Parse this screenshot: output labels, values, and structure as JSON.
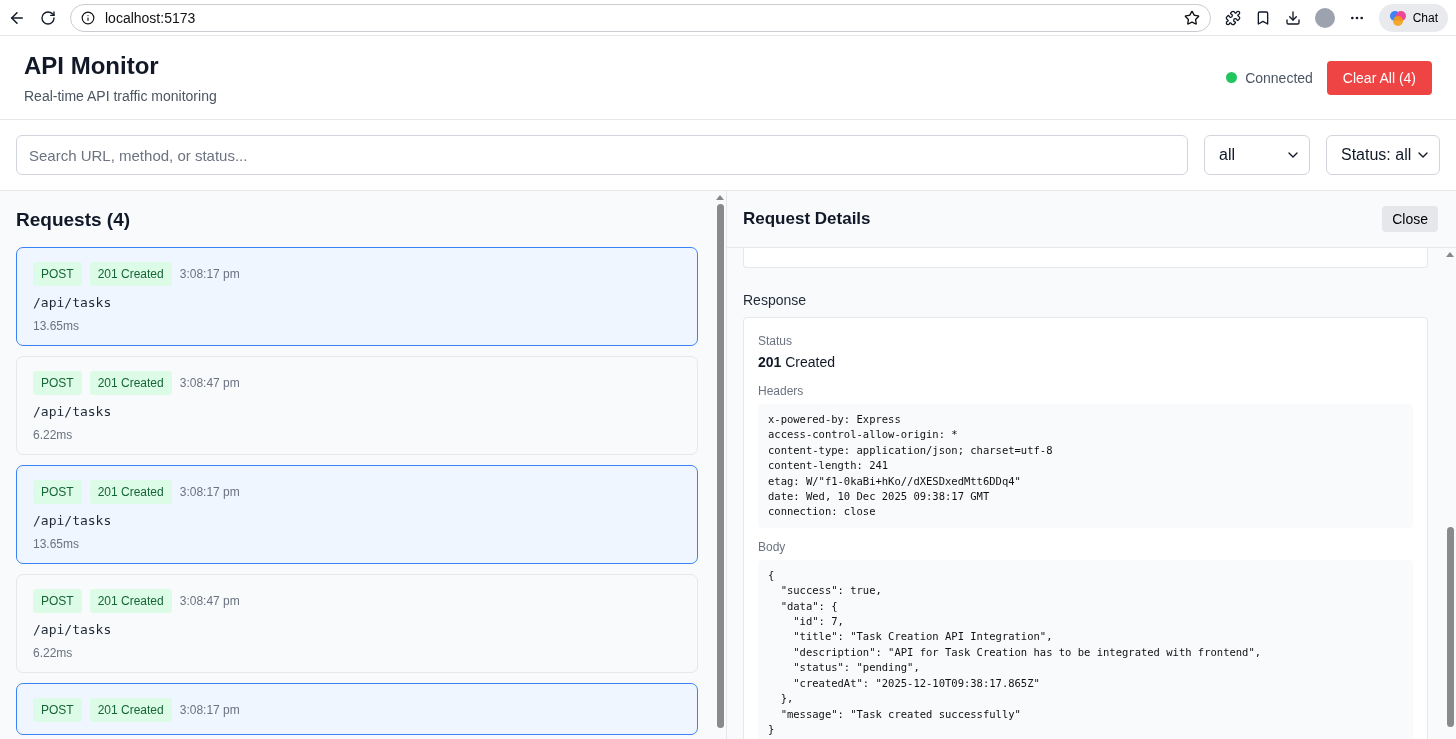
{
  "browser": {
    "url": "localhost:5173",
    "chat_label": "Chat"
  },
  "header": {
    "title": "API Monitor",
    "subtitle": "Real-time API traffic monitoring",
    "connection": {
      "label": "Connected",
      "connected": true
    },
    "clear_button": "Clear All (4)"
  },
  "filters": {
    "search": {
      "placeholder": "Search URL, method, or status..."
    },
    "method_select": "all",
    "status_select": "Status: all"
  },
  "requests": {
    "title": "Requests (4)",
    "items": [
      {
        "method": "POST",
        "status": "201 Created",
        "time": "3:08:17 pm",
        "url": "/api/tasks",
        "duration": "13.65ms",
        "selected": true
      },
      {
        "method": "POST",
        "status": "201 Created",
        "time": "3:08:47 pm",
        "url": "/api/tasks",
        "duration": "6.22ms",
        "selected": false
      },
      {
        "method": "POST",
        "status": "201 Created",
        "time": "3:08:17 pm",
        "url": "/api/tasks",
        "duration": "13.65ms",
        "selected": true
      },
      {
        "method": "POST",
        "status": "201 Created",
        "time": "3:08:47 pm",
        "url": "/api/tasks",
        "duration": "6.22ms",
        "selected": false
      },
      {
        "method": "POST",
        "status": "201 Created",
        "time": "3:08:17 pm",
        "selected": true
      }
    ]
  },
  "details": {
    "title": "Request Details",
    "close_button": "Close",
    "response": {
      "section_title": "Response",
      "status_label": "Status",
      "status_code": "201",
      "status_text": "Created",
      "headers_label": "Headers",
      "headers": "x-powered-by: Express\naccess-control-allow-origin: *\ncontent-type: application/json; charset=utf-8\ncontent-length: 241\netag: W/\"f1-0kaBi+hKo//dXESDxedMtt6DDq4\"\ndate: Wed, 10 Dec 2025 09:38:17 GMT\nconnection: close",
      "body_label": "Body",
      "body": "{\n  \"success\": true,\n  \"data\": {\n    \"id\": 7,\n    \"title\": \"Task Creation API Integration\",\n    \"description\": \"API for Task Creation has to be integrated with frontend\",\n    \"status\": \"pending\",\n    \"createdAt\": \"2025-12-10T09:38:17.865Z\"\n  },\n  \"message\": \"Task created successfully\"\n}"
    }
  }
}
